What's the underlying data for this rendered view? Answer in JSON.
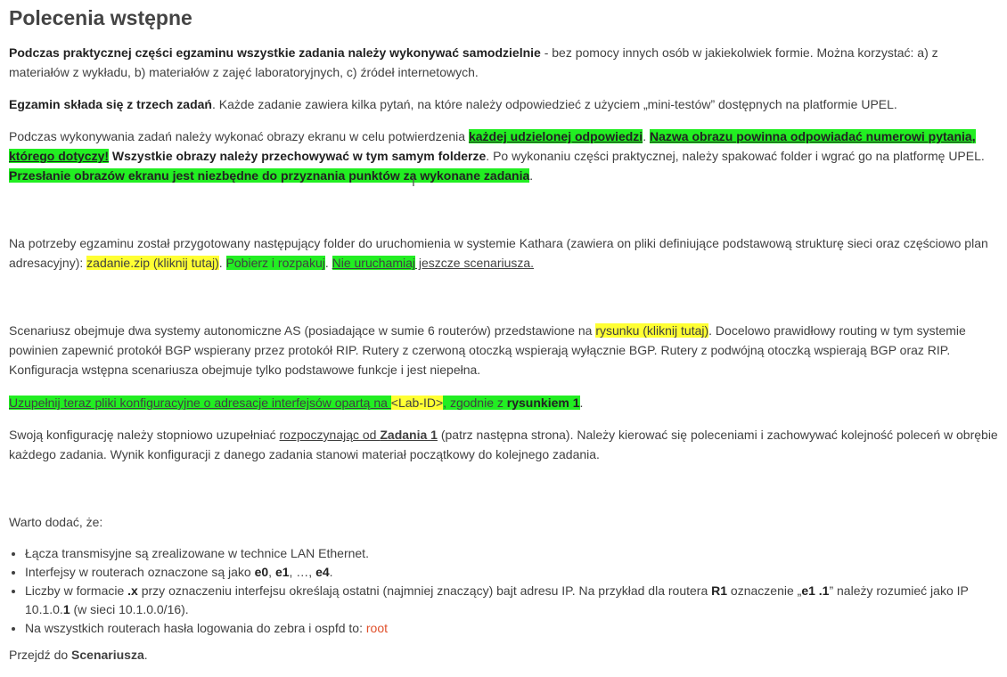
{
  "title": "Polecenia wstępne",
  "p1": {
    "bold": "Podczas praktycznej części egzaminu wszystkie zadania należy wykonywać samodzielnie",
    "rest": " - bez pomocy innych osób w jakiekolwiek formie. Można korzystać: a) z materiałów z wykładu, b) materiałów z zajęć laboratoryjnych, c) źródeł internetowych."
  },
  "p2": {
    "bold": "Egzamin składa się z trzech zadań",
    "rest": ". Każde zadanie zawiera kilka pytań, na które należy odpowiedzieć z użyciem „mini-testów” dostępnych na platformie UPEL."
  },
  "p3": {
    "t1": "Podczas wykonywania zadań należy wykonać obrazy ekranu w celu potwierdzenia ",
    "h1": "każdej udzielonej odpowiedzi",
    "t2": ". ",
    "h2": "Nazwa obrazu powinna odpowiadać numerowi pytania, którego dotyczy!",
    "t3": " ",
    "b1": "Wszystkie obrazy należy przechowywać w tym samym folderze",
    "t4": ". Po wykonaniu części praktycznej, należy spakować folder i wgrać go na platformę UPEL. ",
    "h3": "Przesłanie obrazów ekranu jest niezbędne do przyznania punktów za wykonane zadania",
    "t5": "."
  },
  "p4": {
    "t1": "Na potrzeby egzaminu został przygotowany następujący folder do uruchomienia w systemie Kathara (zawiera on pliki definiujące podstawową strukturę sieci oraz częściowo plan adresacyjny): ",
    "link": "zadanie.zip (kliknij tutaj)",
    "t2": ". ",
    "h1": "Pobierz i rozpakuj",
    "t3": ". ",
    "h2": " Nie uruchamiaj",
    "t4": " jeszcze scenariusza."
  },
  "p5": {
    "t1": "Scenariusz obejmuje dwa systemy autonomiczne AS (posiadające w sumie 6 routerów) przedstawione na ",
    "link": "rysunku (kliknij tutaj)",
    "t2": ". Docelowo prawidłowy routing w tym systemie powinien zapewnić protokół BGP wspierany przez protokół RIP. Rutery z czerwoną otoczką wspierają wyłącznie BGP. Rutery z podwójną otoczką wspierają BGP oraz RIP. Konfiguracja wstępna scenariusza obejmuje tylko podstawowe funkcje i jest niepełna."
  },
  "p6": {
    "t1": "Uzupełnij teraz pliki konfiguracyjne o adresacje interfejsów opartą na ",
    "lab": "<Lab-ID>",
    "t2": ", zgodnie z ",
    "b1": "rysunkiem 1",
    "t3": "."
  },
  "p7": {
    "t1": "Swoją konfigurację należy stopniowo uzupełniać ",
    "u1": "rozpoczynając od ",
    "b1": " Zadania 1",
    "t2": " (patrz następna strona). Należy kierować się poleceniami i zachowywać kolejność poleceń w obrębie każdego zadania. Wynik konfiguracji z danego zadania stanowi materiał początkowy do kolejnego zadania."
  },
  "p8": "Warto dodać, że:",
  "bullets": {
    "b1": "Łącza transmisyjne są zrealizowane w technice LAN Ethernet.",
    "b2": {
      "t1": "Interfejsy w routerach oznaczone są jako ",
      "e0": "e0",
      "sep1": ", ",
      "e1": "e1",
      "sep2": ", …, ",
      "e4": "e4",
      "t2": "."
    },
    "b3": {
      "t1": "Liczby w formacie ",
      "x": ".x",
      "t2": " przy oznaczeniu interfejsu określają ostatni (najmniej znaczący) bajt adresu IP. Na przykład dla routera ",
      "r1": "R1",
      "t3": " oznaczenie „",
      "e1": "e1 .1",
      "t4": "”  należy rozumieć jako IP 10.1.0.",
      "one": "1",
      "t5": " (w sieci 10.1.0.0/16)."
    },
    "b4": {
      "t1": "Na wszystkich routerach hasła logowania do zebra i ospfd to:  ",
      "pw": "root"
    }
  },
  "p9": {
    "t1": "Przejdź do ",
    "b1": "Scenariusza",
    "t2": "."
  },
  "colors": {
    "highlight_green": "#22ee22",
    "highlight_yellow": "#ffff33",
    "password_red": "#e0502b"
  }
}
